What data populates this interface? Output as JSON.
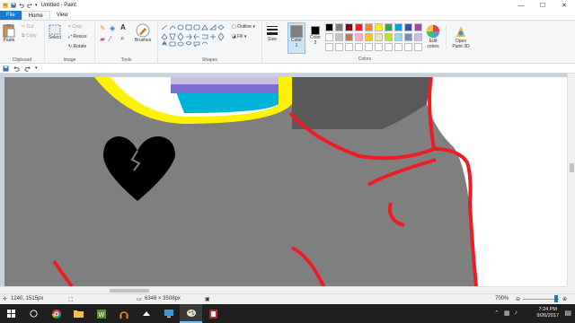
{
  "window": {
    "title": "Untitled - Paint",
    "minimize": "—",
    "maximize": "☐",
    "close": "✕"
  },
  "tabs": [
    "File",
    "Home",
    "View"
  ],
  "ribbon": {
    "clipboard": {
      "paste": "Paste",
      "cut": "Cut",
      "copy": "Copy",
      "label": "Clipboard"
    },
    "image": {
      "select": "Select",
      "crop": "Crop",
      "resize": "Resize",
      "rotate": "Rotate",
      "label": "Image"
    },
    "tools": {
      "label": "Tools",
      "brushes": "Brushes"
    },
    "shapes": {
      "label": "Shapes",
      "outline": "Outline",
      "fill": "Fill"
    },
    "size": {
      "label": "Size"
    },
    "color1": {
      "label": "Color",
      "num": "1"
    },
    "color2": {
      "label": "Color",
      "num": "2"
    },
    "colors": {
      "label": "Colors",
      "edit": "Edit colors",
      "paint3d": "Open Paint 3D",
      "row1": [
        "#000000",
        "#7f7f7f",
        "#880015",
        "#ed1c24",
        "#ff7f27",
        "#fff200",
        "#22b14c",
        "#00a2e8",
        "#3f48cc",
        "#a349a4"
      ],
      "row2": [
        "#ffffff",
        "#c3c3c3",
        "#b97a57",
        "#ffaec9",
        "#ffc90e",
        "#efe4b0",
        "#b5e61d",
        "#99d9ea",
        "#7092be",
        "#c8bfe7"
      ],
      "row3": [
        "#ffffff",
        "#ffffff",
        "#ffffff",
        "#ffffff",
        "#ffffff",
        "#ffffff",
        "#ffffff",
        "#ffffff",
        "#ffffff",
        "#ffffff"
      ],
      "color1_value": "#7f7f7f",
      "color2_value": "#000000"
    }
  },
  "status": {
    "cursor": "1240, 1515px",
    "size": "6348 × 3508px",
    "zoom": "700%"
  },
  "taskbar": {
    "time": "7:24 PM",
    "date": "9/26/2017"
  }
}
